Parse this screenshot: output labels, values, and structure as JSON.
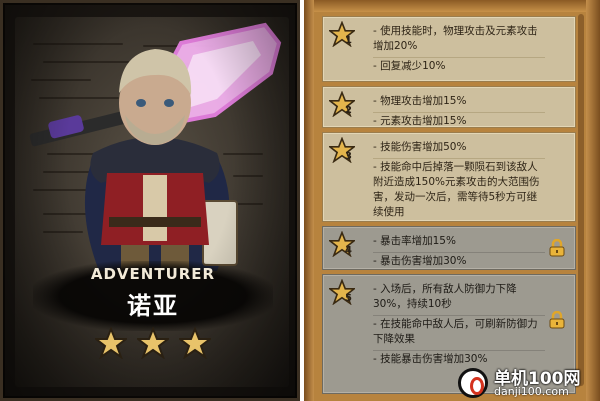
{
  "hero_card": {
    "class_label": "ADVENTURER",
    "name": "诺亚",
    "star_rating": 3,
    "star_max": 3,
    "star_color": "#e8c36a",
    "aura_color": "#e98be8"
  },
  "upgrades": [
    {
      "tier": "1",
      "locked": false,
      "lines": [
        "- 使用技能时，物理攻击及元素攻击增加20%",
        "- 回复减少10%"
      ]
    },
    {
      "tier": "2",
      "locked": false,
      "lines": [
        "- 物理攻击增加15%",
        "- 元素攻击增加15%"
      ]
    },
    {
      "tier": "3",
      "locked": false,
      "lines": [
        "- 技能伤害增加50%",
        "- 技能命中后掉落一颗陨石到该敌人附近造成150%元素攻击的大范围伤害，发动一次后，需等待5秒方可继续使用"
      ]
    },
    {
      "tier": "4",
      "locked": true,
      "lines": [
        "- 暴击率增加15%",
        "- 暴击伤害增加30%"
      ]
    },
    {
      "tier": "5",
      "locked": true,
      "lines": [
        "- 入场后，所有敌人防御力下降30%，持续10秒",
        "- 在技能命中敌人后，可刷新防御力下降效果",
        "- 技能暴击伤害增加30%"
      ]
    }
  ],
  "colors": {
    "panel_frame": "#b7833e",
    "tier_bg": "#cdbf9e",
    "tier_locked_bg": "#9d9a90",
    "star_badge": "#e4b54c"
  },
  "watermark": {
    "site_name": "单机100网",
    "site_url": "danji100.com"
  }
}
